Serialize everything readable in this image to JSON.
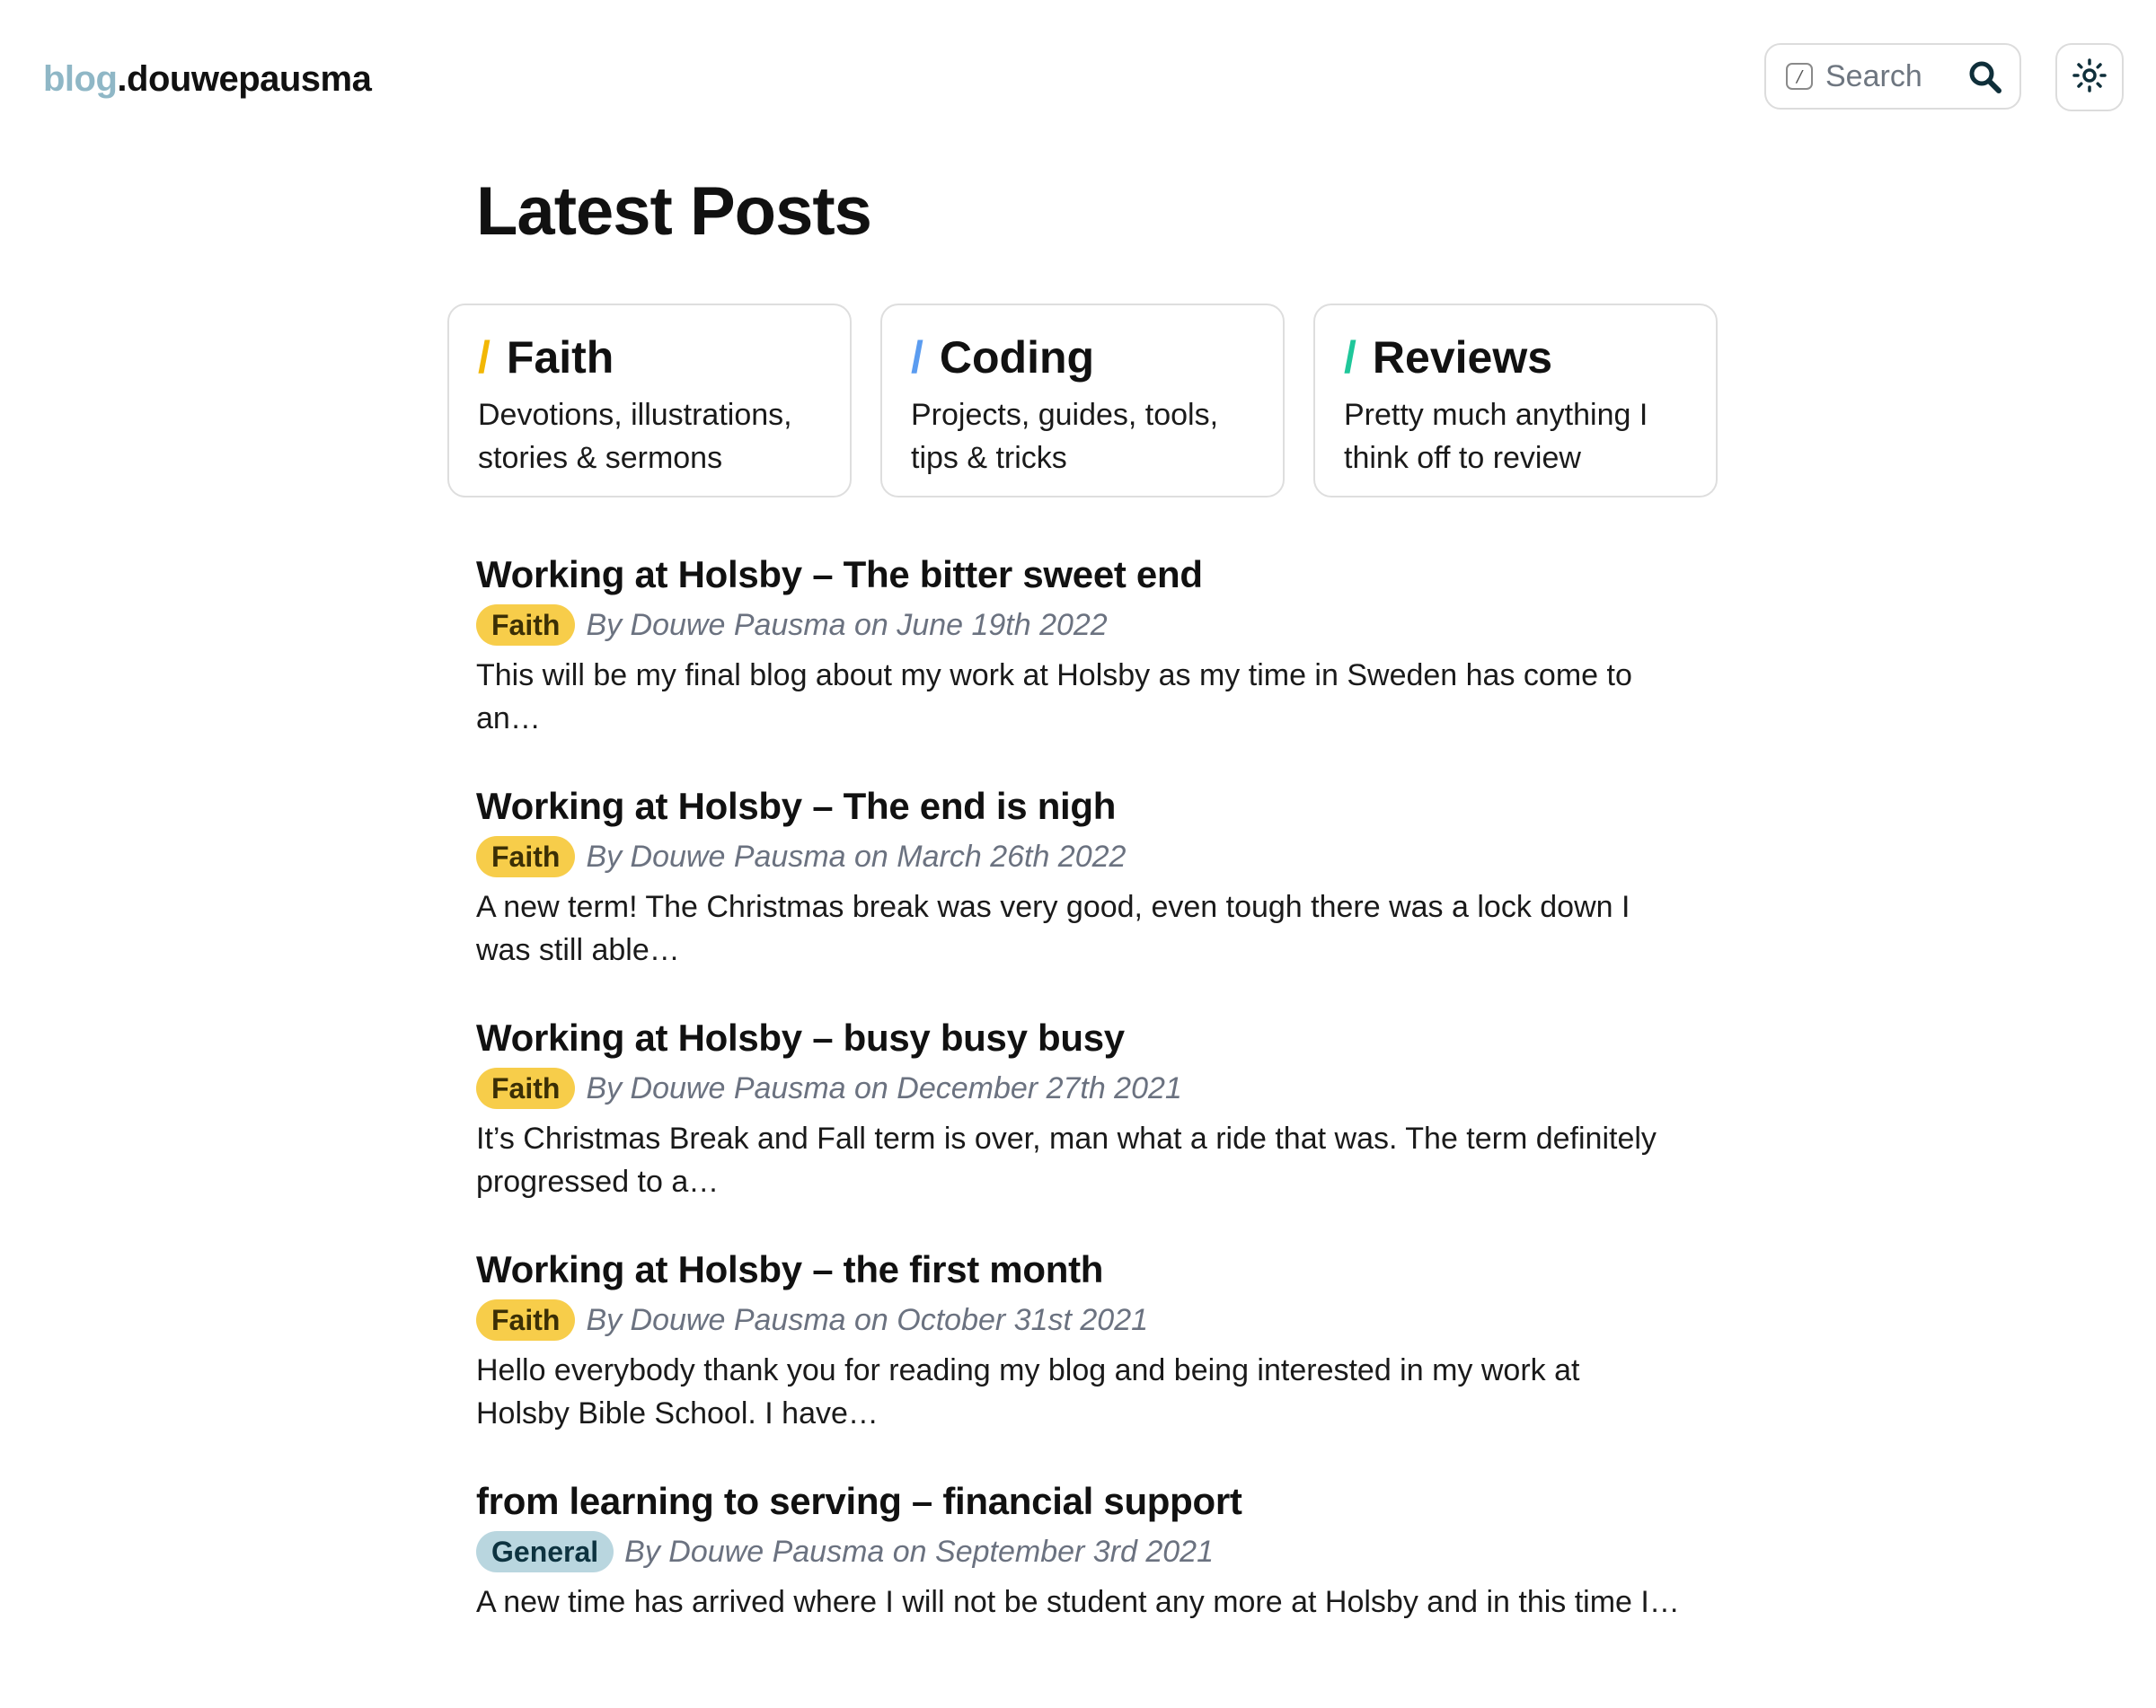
{
  "header": {
    "logo_prefix": "blog",
    "logo_main": ".douwepausma",
    "search": {
      "placeholder": "Search",
      "shortcut_key": "/"
    },
    "theme_toggle_icon": "sun-icon",
    "search_icon": "search-icon"
  },
  "main": {
    "title": "Latest Posts",
    "categories": [
      {
        "name": "Faith",
        "slash": "/",
        "color": "#f2b705",
        "description": "Devotions, illustrations, stories & sermons"
      },
      {
        "name": "Coding",
        "slash": "/",
        "color": "#5b9cf0",
        "description": "Projects, guides, tools, tips & tricks"
      },
      {
        "name": "Reviews",
        "slash": "/",
        "color": "#1fc79a",
        "description": "Pretty much anything I think off to review"
      }
    ],
    "posts": [
      {
        "title": "Working at Holsby – The bitter sweet end",
        "tag": "Faith",
        "byline": "By Douwe Pausma on June 19th 2022",
        "excerpt": "This will be my final blog about my work at Holsby as my time in Sweden has come to an…"
      },
      {
        "title": "Working at Holsby – The end is nigh",
        "tag": "Faith",
        "byline": "By Douwe Pausma on March 26th 2022",
        "excerpt": "A new term! The Christmas break was very good, even tough there was a lock down I was still able…"
      },
      {
        "title": "Working at Holsby – busy busy busy",
        "tag": "Faith",
        "byline": "By Douwe Pausma on December 27th 2021",
        "excerpt": "It’s Christmas Break and Fall term is over, man what a ride that was. The term definitely progressed to a…"
      },
      {
        "title": "Working at Holsby – the first month",
        "tag": "Faith",
        "byline": "By Douwe Pausma on October 31st 2021",
        "excerpt": "Hello everybody thank you for reading my blog and being interested in my work at Holsby Bible School. I have…"
      },
      {
        "title": "from learning to serving – financial support",
        "tag": "General",
        "byline": "By Douwe Pausma on September 3rd 2021",
        "excerpt": "A new time has arrived where I will not be student any more at Holsby and in this time I…"
      }
    ]
  },
  "colors": {
    "logo_prefix": "#8fb7c6",
    "tag_faith": "#f7cd4a",
    "tag_general": "#b9d6df",
    "byline": "#6b7280"
  }
}
